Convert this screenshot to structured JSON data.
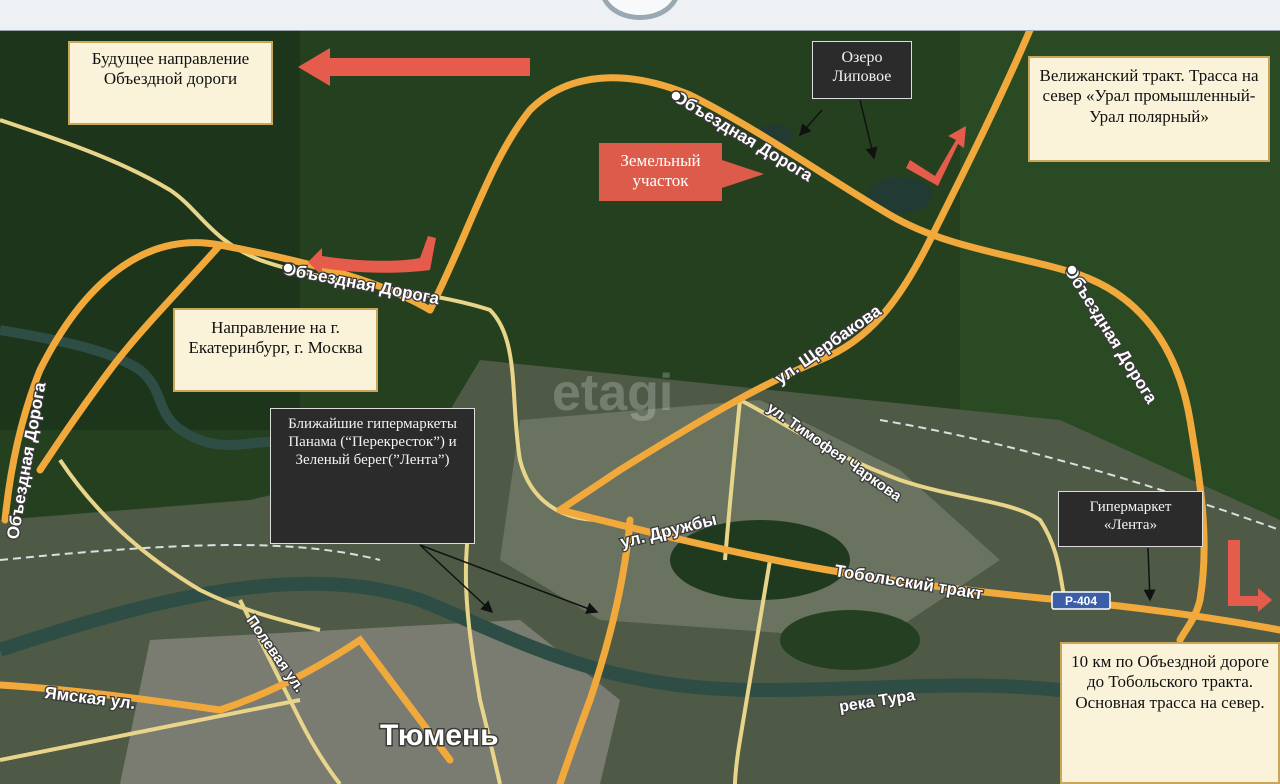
{
  "header": {
    "logo": "round-emblem"
  },
  "colors": {
    "road_major": "#f2a93b",
    "road_minor": "#e8d58a",
    "arrow": "#e55b4c",
    "forest": "#1f3a1e"
  },
  "labels": {
    "future_direction": "Будущее направление Объездной дороги",
    "lake": "Озеро Липовое",
    "velizhansky": "Велижанский тракт. Трасса на север «Урал промышленный-Урал полярный»",
    "land_plot": "Земельный участок",
    "ekb_direction": "Направление на г. Екатеринбург, г. Москва",
    "hypermarkets": "Ближайшие гипермаркеты Панама (“Перекресток”) и Зеленый берег(”Лента”)",
    "lenta": "Гипермаркет «Лента»",
    "distance_note": "10 км по Объездной дороге до Тобольского тракта. Основная трасса на север."
  },
  "map_labels": {
    "ring_top": "Объездная Дорога",
    "ring_left": "Объездная Дорога",
    "ring_right": "Объездная Дорога",
    "ring_far_left": "Объездная Дорога",
    "shcherbakova": "ул. Щербакова",
    "timofeya": "ул. Тимофея Чаркова",
    "druzhby": "ул. Дружбы",
    "tobolsky": "Тобольский тракт",
    "r404": "Р-404",
    "polevaya": "Полевая ул.",
    "yamskaya": "Ямская ул.",
    "tura": "река Тура",
    "city": "Тюмень",
    "watermark": "etagi"
  }
}
